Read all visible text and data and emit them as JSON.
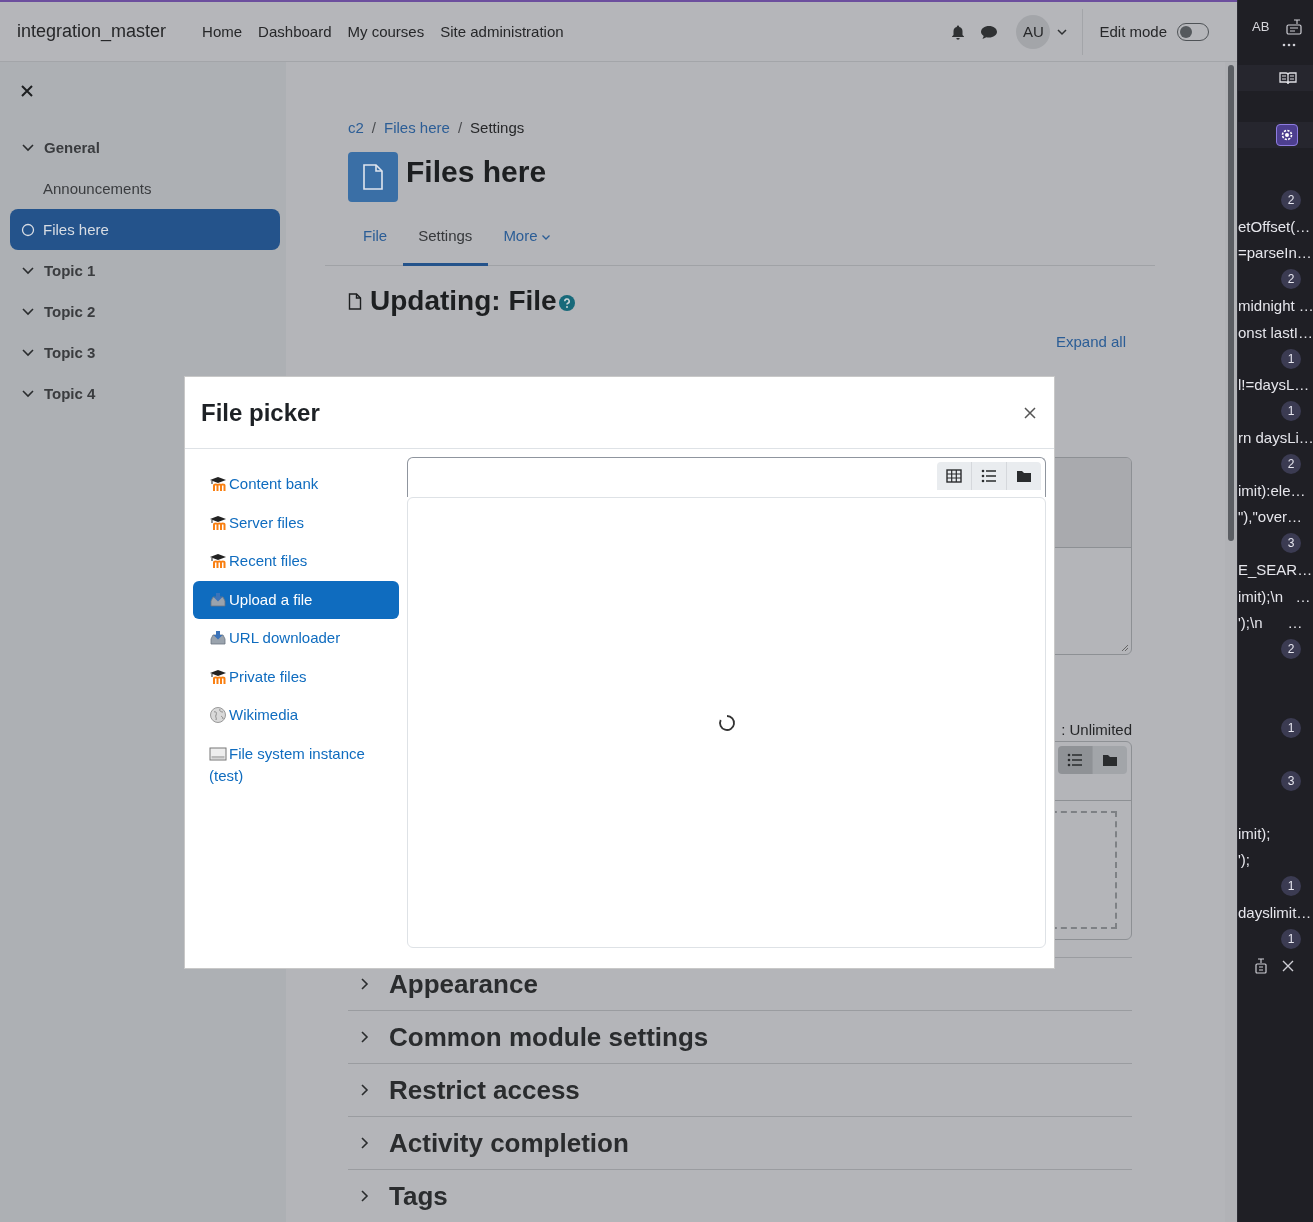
{
  "header": {
    "brand": "integration_master",
    "nav": [
      {
        "label": "Home"
      },
      {
        "label": "Dashboard"
      },
      {
        "label": "My courses"
      },
      {
        "label": "Site administration"
      }
    ],
    "avatar": "AU",
    "edit_mode": {
      "label": "Edit mode",
      "on": false
    }
  },
  "sidebar": {
    "items": [
      {
        "kind": "section",
        "label": "General",
        "expanded": true,
        "children": [
          {
            "kind": "activity",
            "label": "Announcements",
            "selected": false
          },
          {
            "kind": "activity",
            "label": "Files here",
            "selected": true
          }
        ]
      },
      {
        "kind": "section",
        "label": "Topic 1",
        "expanded": true
      },
      {
        "kind": "section",
        "label": "Topic 2",
        "expanded": true
      },
      {
        "kind": "section",
        "label": "Topic 3",
        "expanded": true
      },
      {
        "kind": "section",
        "label": "Topic 4",
        "expanded": true
      }
    ]
  },
  "breadcrumb_separator": "/",
  "breadcrumb": [
    {
      "label": "c2",
      "link": true
    },
    {
      "label": "Files here",
      "link": true
    },
    {
      "label": "Settings",
      "link": false
    }
  ],
  "page_title": "Files here",
  "tabs": [
    {
      "label": "File",
      "selected": false,
      "kind": "link"
    },
    {
      "label": "Settings",
      "selected": true,
      "kind": "link"
    },
    {
      "label": "More",
      "selected": false,
      "kind": "menu"
    }
  ],
  "form": {
    "title": "Updating: File",
    "expand_all": "Expand all",
    "limit_text": ": Unlimited",
    "file_manager_views": [
      {
        "kind": "list",
        "selected": true
      },
      {
        "kind": "folder",
        "selected": false
      }
    ],
    "sections": [
      {
        "label": "Appearance",
        "expanded": false
      },
      {
        "label": "Common module settings",
        "expanded": false
      },
      {
        "label": "Restrict access",
        "expanded": false
      },
      {
        "label": "Activity completion",
        "expanded": false
      },
      {
        "label": "Tags",
        "expanded": false
      }
    ]
  },
  "file_picker": {
    "title": "File picker",
    "loading": true,
    "repositories": [
      {
        "label": "Content bank",
        "kind": "moodle",
        "selected": false
      },
      {
        "label": "Server files",
        "kind": "moodle",
        "selected": false
      },
      {
        "label": "Recent files",
        "kind": "moodle",
        "selected": false
      },
      {
        "label": "Upload a file",
        "kind": "upload",
        "selected": true
      },
      {
        "label": "URL downloader",
        "kind": "upload",
        "selected": false
      },
      {
        "label": "Private files",
        "kind": "moodle",
        "selected": false
      },
      {
        "label": "Wikimedia",
        "kind": "globe",
        "selected": false
      },
      {
        "label": "File system instance (test)",
        "kind": "drive",
        "selected": false
      }
    ],
    "views": [
      {
        "kind": "grid",
        "selected": false
      },
      {
        "kind": "list",
        "selected": false
      },
      {
        "kind": "folder",
        "selected": false
      }
    ]
  },
  "side_panel": {
    "case_button": "AB",
    "items": [
      {
        "kind": "badge",
        "text": "2"
      },
      {
        "kind": "line",
        "text": "etOffset(…"
      },
      {
        "kind": "line",
        "text": "=parseIn…"
      },
      {
        "kind": "badge",
        "text": "2"
      },
      {
        "kind": "line",
        "text": "midnight …"
      },
      {
        "kind": "line",
        "text": "onst lastI…"
      },
      {
        "kind": "badge",
        "text": "1"
      },
      {
        "kind": "line",
        "text": "l!=daysL…"
      },
      {
        "kind": "badge",
        "text": "1"
      },
      {
        "kind": "line",
        "text": "rn daysLi…"
      },
      {
        "kind": "badge",
        "text": "2"
      },
      {
        "kind": "line",
        "text": "imit):ele…"
      },
      {
        "kind": "line",
        "text": "\"),\"over…"
      },
      {
        "kind": "badge",
        "text": "3"
      },
      {
        "kind": "line",
        "text": "E_SEAR…"
      },
      {
        "kind": "line",
        "text": "imit);\\n   …"
      },
      {
        "kind": "line",
        "text": "');\\n      …"
      },
      {
        "kind": "badge",
        "text": "2"
      },
      {
        "kind": "spacer"
      },
      {
        "kind": "spacer"
      },
      {
        "kind": "badge",
        "text": "1"
      },
      {
        "kind": "spacer"
      },
      {
        "kind": "badge",
        "text": "3"
      },
      {
        "kind": "spacer"
      },
      {
        "kind": "line",
        "text": "imit);"
      },
      {
        "kind": "line",
        "text": "');"
      },
      {
        "kind": "badge",
        "text": "1"
      },
      {
        "kind": "line",
        "text": "dayslimit…"
      },
      {
        "kind": "badge",
        "text": "1"
      }
    ]
  }
}
